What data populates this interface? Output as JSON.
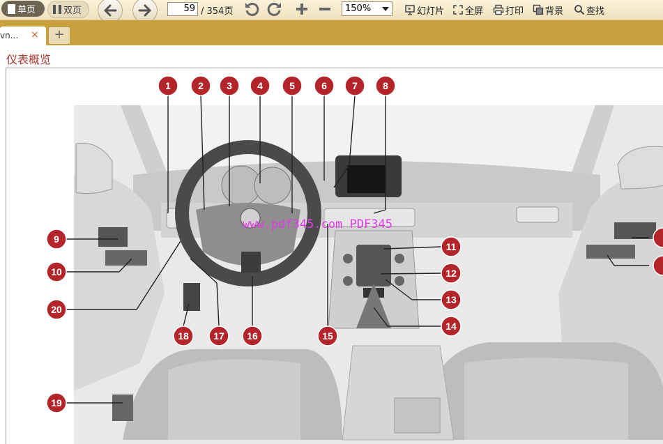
{
  "toolbar": {
    "single_page": "单页",
    "double_page": "双页",
    "current_page": "59",
    "total_pages": "/ 354页",
    "zoom": "150%",
    "slideshow": "幻灯片",
    "fullscreen": "全屏",
    "print": "打印",
    "background": "背景",
    "find": "查找"
  },
  "tabs": [
    {
      "label": "vn...",
      "close": "×"
    }
  ],
  "new_tab": "+",
  "page": {
    "title": "仪表概览",
    "watermark": "www.pdf345.com PDF345",
    "callouts": [
      "1",
      "2",
      "3",
      "4",
      "5",
      "6",
      "7",
      "8",
      "9",
      "10",
      "11",
      "12",
      "13",
      "14",
      "15",
      "16",
      "17",
      "18",
      "19",
      "20"
    ]
  },
  "colors": {
    "callout": "#b3252b",
    "title": "#a8362f",
    "watermark": "#e23ae6",
    "tab_strip": "#c9a13f",
    "toolbar": "#f3e8c8"
  }
}
